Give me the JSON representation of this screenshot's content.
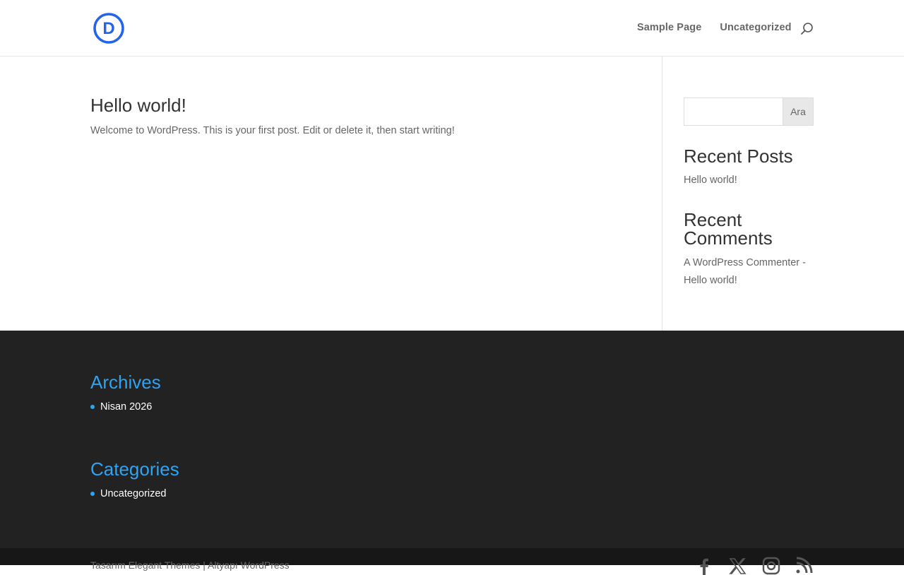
{
  "header": {
    "logo_letter": "D",
    "nav": {
      "sample_page": "Sample Page",
      "uncategorized": "Uncategorized"
    },
    "icons": {
      "search": "search-icon"
    }
  },
  "post": {
    "title": "Hello world!",
    "excerpt": "Welcome to WordPress. This is your first post. Edit or delete it, then start writing!"
  },
  "sidebar": {
    "search": {
      "placeholder": "",
      "button_label": "Ara"
    },
    "recent_posts": {
      "title": "Recent Posts",
      "items": [
        "Hello world!"
      ]
    },
    "recent_comments": {
      "title_line1": "Recent",
      "title_line2": "Comments",
      "author": "A WordPress Commenter -",
      "post": "Hello world!"
    }
  },
  "footer": {
    "archives": {
      "title": "Archives",
      "items": [
        "Nisan 2026"
      ]
    },
    "categories": {
      "title": "Categories",
      "items": [
        "Uncategorized"
      ]
    },
    "credits": "Tasarım Elegant Themes | Altyapı WordPress",
    "social": [
      "facebook-icon",
      "x-icon",
      "instagram-icon",
      "rss-icon"
    ]
  },
  "colors": {
    "accent": "#2ea3f2",
    "logo_blue": "#2563eb",
    "footer_bg": "#222222",
    "bottom_bg": "#171717"
  }
}
